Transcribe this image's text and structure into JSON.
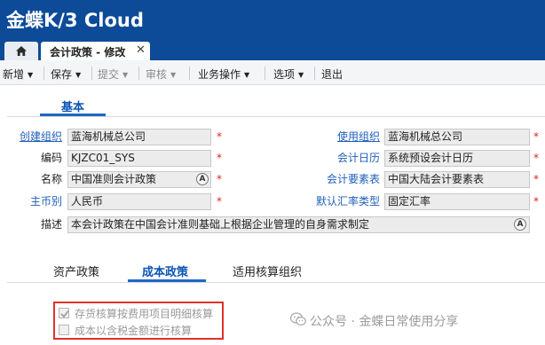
{
  "app": {
    "brand": "金蝶K/3 Cloud",
    "brand_color": "#0d4b98",
    "accent_color": "#1f67c4",
    "required_color": "#d8261b"
  },
  "tabs": {
    "home_icon": "home-icon",
    "active_tab_label": "会计政策 - 修改",
    "close_icon": "close-icon"
  },
  "toolbar": {
    "items": [
      {
        "label": "新增",
        "has_menu": true,
        "disabled": false
      },
      {
        "label": "保存",
        "has_menu": true,
        "disabled": false
      },
      {
        "label": "提交",
        "has_menu": true,
        "disabled": true
      },
      {
        "label": "审核",
        "has_menu": true,
        "disabled": true
      },
      {
        "label": "业务操作",
        "has_menu": true,
        "disabled": false
      },
      {
        "label": "选项",
        "has_menu": true,
        "disabled": false
      },
      {
        "label": "退出",
        "has_menu": false,
        "disabled": false
      }
    ]
  },
  "section": {
    "tab_label": "基本"
  },
  "form": {
    "create_org": {
      "label": "创建组织",
      "value": "蓝海机械总公司",
      "required": "*"
    },
    "use_org": {
      "label": "使用组织",
      "value": "蓝海机械总公司",
      "required": "*"
    },
    "code": {
      "label": "编码",
      "value": "KJZC01_SYS",
      "required": "*"
    },
    "calendar": {
      "label": "会计日历",
      "value": "系统预设会计日历",
      "required": "*"
    },
    "name": {
      "label": "名称",
      "value": "中国准则会计政策",
      "required": "*"
    },
    "elements": {
      "label": "会计要素表",
      "value": "中国大陆会计要素表",
      "required": "*"
    },
    "currency": {
      "label": "主币别",
      "value": "人民币",
      "required": "*"
    },
    "rate_type": {
      "label": "默认汇率类型",
      "value": "固定汇率",
      "required": "*"
    },
    "description": {
      "label": "描述",
      "value": "本会计政策在中国会计准则基础上根据企业管理的自身需求制定"
    },
    "multilang_icon": "A"
  },
  "subtabs": {
    "asset": "资产政策",
    "cost": "成本政策",
    "accounting_org": "适用核算组织"
  },
  "cost_policy": {
    "inventory_checkbox": {
      "label": "存货核算按费用项目明细核算",
      "checked": true
    },
    "tax_checkbox": {
      "label": "成本以含税金额进行核算",
      "checked": false
    }
  },
  "watermark": {
    "text": "公众号 · 金蝶日常使用分享"
  }
}
